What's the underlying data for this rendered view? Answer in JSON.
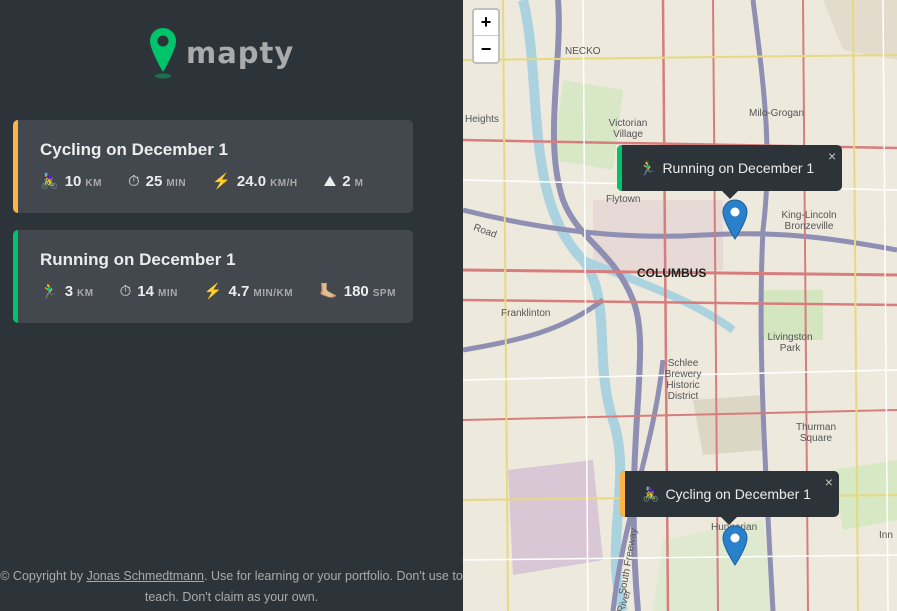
{
  "logo": {
    "text": "mapty"
  },
  "workouts": [
    {
      "type": "cycling",
      "title": "Cycling on December 1",
      "details": [
        {
          "icon": "🚴‍♀️",
          "value": "10",
          "unit": "km"
        },
        {
          "icon": "⏱",
          "value": "25",
          "unit": "min"
        },
        {
          "icon": "⚡️",
          "value": "24.0",
          "unit": "km/h"
        },
        {
          "icon": "⛰",
          "value": "2",
          "unit": "m"
        }
      ]
    },
    {
      "type": "running",
      "title": "Running on December 1",
      "details": [
        {
          "icon": "🏃‍♂️",
          "value": "3",
          "unit": "km"
        },
        {
          "icon": "⏱",
          "value": "14",
          "unit": "min"
        },
        {
          "icon": "⚡️",
          "value": "4.7",
          "unit": "min/km"
        },
        {
          "icon": "🦶🏼",
          "value": "180",
          "unit": "spm"
        }
      ]
    }
  ],
  "footer": {
    "prefix": "© Copyright by ",
    "author": "Jonas Schmedtmann",
    "suffix": ". Use for learning or your portfolio. Don't use to teach. Don't claim as your own."
  },
  "map": {
    "zoom_in": "+",
    "zoom_out": "−",
    "popups": [
      {
        "type": "running",
        "icon": "🏃‍♂️",
        "text": "Running on December 1",
        "close": "×"
      },
      {
        "type": "cycling",
        "icon": "🚴‍♀️",
        "text": "Cycling on December 1",
        "close": "×"
      }
    ],
    "labels": {
      "necko": "NECKO",
      "heights": "Heights",
      "victorian": "Victorian Village",
      "milo": "Milo-Grogan",
      "flytown": "Flytown",
      "road": "Road",
      "columbus": "COLUMBUS",
      "king": "King-Lincoln Bronzeville",
      "franklinton": "Franklinton",
      "livingston": "Livingston Park",
      "schlee": "Schlee Brewery Historic District",
      "thurman": "Thurman Square",
      "hungarian": "Hungarian",
      "freeway": "South Freeway",
      "inn": "Inn",
      "river": "River"
    },
    "colors": {
      "running": "#00c46a",
      "cycling": "#ffb545",
      "marker": "#2a81cb"
    }
  }
}
